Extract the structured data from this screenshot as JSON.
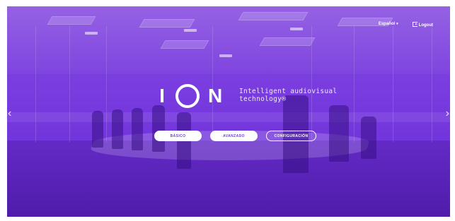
{
  "header": {
    "language_label": "Español",
    "logout_label": "Logout"
  },
  "brand": {
    "logo_left": "I",
    "logo_right": "N",
    "tagline_line1": "Intelligent audiovisual",
    "tagline_line2": "technology®"
  },
  "modes": {
    "basic_label": "BÁSICO",
    "advanced_label": "AVANZADO",
    "config_label": "CONFIGURACIÓN"
  },
  "carousel": {
    "prev_glyph": "‹",
    "next_glyph": "›"
  },
  "colors": {
    "accent": "#7a3fe0",
    "button_text": "#6f3fd9",
    "white": "#ffffff"
  }
}
